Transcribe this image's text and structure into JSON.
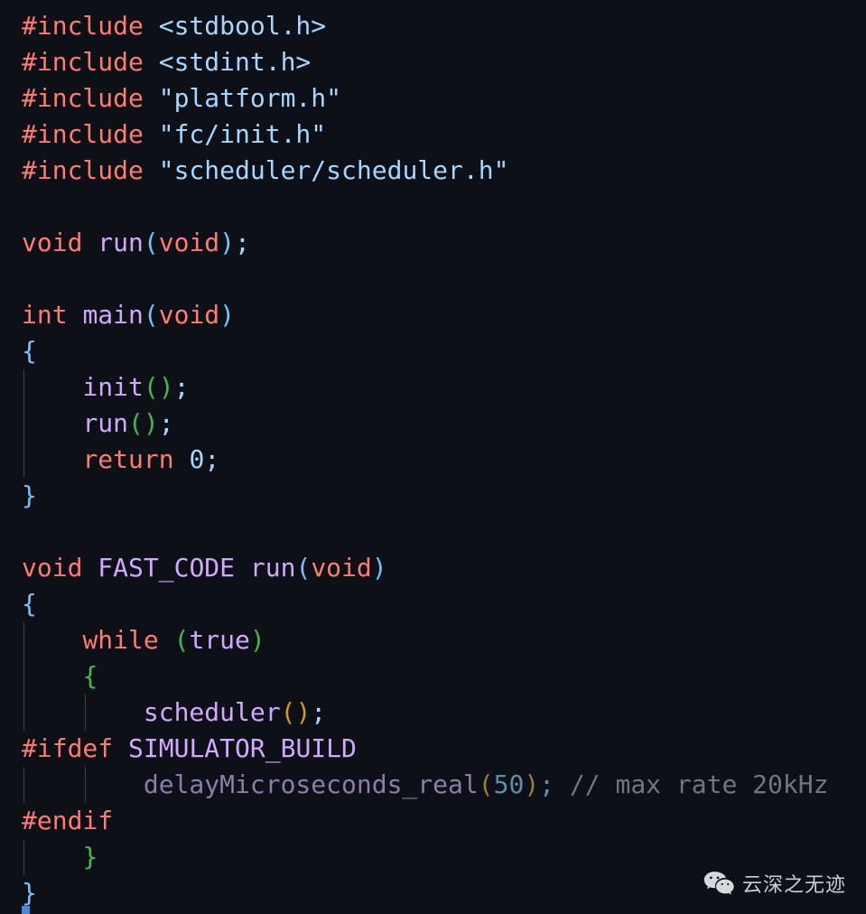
{
  "editor": {
    "language": "c",
    "theme": "github-dark",
    "background": "#0d1117",
    "font_size_px": 28,
    "line_height_px": 40,
    "colors": {
      "keyword": "#ff7b72",
      "preprocessor": "#ff7b72",
      "string": "#a5d6ff",
      "function": "#d2a8ff",
      "constant": "#d2a8ff",
      "number": "#a5d6ff",
      "comment": "#6e7681",
      "bracket_depth_1": "#79c0ff",
      "bracket_depth_2": "#3fb950",
      "bracket_depth_3": "#d29922",
      "indent_guide": "#3b4049",
      "cursor": "#4a86d8",
      "dimmed_function": "#8b7da8",
      "dimmed_number": "#5b90a8",
      "dimmed_bracket": "#9c7e34"
    }
  },
  "code": {
    "line1": {
      "pre": "#include",
      "space": " ",
      "str": "<stdbool.h>"
    },
    "line2": {
      "pre": "#include",
      "space": " ",
      "str": "<stdint.h>"
    },
    "line3": {
      "pre": "#include",
      "space": " ",
      "str": "\"platform.h\""
    },
    "line4": {
      "pre": "#include",
      "space": " ",
      "str": "\"fc/init.h\""
    },
    "line5": {
      "pre": "#include",
      "space": " ",
      "str": "\"scheduler/scheduler.h\""
    },
    "line7": {
      "kw": "void",
      "space": " ",
      "fn": "run",
      "open": "(",
      "arg": "void",
      "close": ")",
      "semi": ";"
    },
    "line9": {
      "kw": "int",
      "space": " ",
      "fn": "main",
      "open": "(",
      "arg": "void",
      "close": ")"
    },
    "line10": {
      "brace": "{"
    },
    "line11": {
      "indent": "    ",
      "fn": "init",
      "open": "(",
      "close": ")",
      "semi": ";"
    },
    "line12": {
      "indent": "    ",
      "fn": "run",
      "open": "(",
      "close": ")",
      "semi": ";"
    },
    "line13": {
      "indent": "    ",
      "kw": "return",
      "space": " ",
      "num": "0",
      "semi": ";"
    },
    "line14": {
      "brace": "}"
    },
    "line16": {
      "kw": "void",
      "space1": " ",
      "macro": "FAST_CODE",
      "space2": " ",
      "fn": "run",
      "open": "(",
      "arg": "void",
      "close": ")"
    },
    "line17": {
      "brace": "{"
    },
    "line18": {
      "indent": "    ",
      "kw": "while",
      "space": " ",
      "open": "(",
      "const": "true",
      "close": ")"
    },
    "line19": {
      "indent": "    ",
      "brace": "{"
    },
    "line20": {
      "indent": "        ",
      "fn": "scheduler",
      "open": "(",
      "close": ")",
      "semi": ";"
    },
    "line21": {
      "pre": "#ifdef",
      "space": " ",
      "macro": "SIMULATOR_BUILD"
    },
    "line22": {
      "indent": "        ",
      "fn": "delayMicroseconds_real",
      "open": "(",
      "num": "50",
      "close": ")",
      "semi": ";",
      "gap": " ",
      "comment": "// max rate 20kHz"
    },
    "line23": {
      "pre": "#endif"
    },
    "line24": {
      "indent": "    ",
      "brace": "}"
    },
    "line25": {
      "brace": "}"
    }
  },
  "watermark": {
    "icon": "wechat-icon",
    "text": "云深之无迹"
  }
}
